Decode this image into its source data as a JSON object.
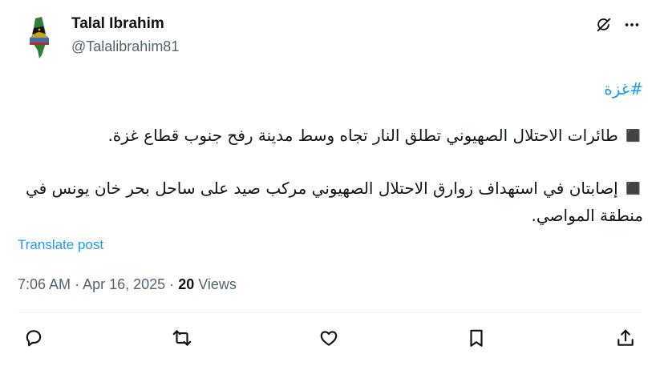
{
  "author": {
    "name": "Talal Ibrahim",
    "handle": "@Talalibrahim81"
  },
  "post": {
    "hashtag": "#غزة",
    "paragraph_1": "◼️ طائرات الاحتلال الصهيوني تطلق النار تجاه وسط مدينة رفح جنوب قطاع غزة.",
    "paragraph_2": "◼️ إصابتان في استهداف زوارق الاحتلال الصهيوني مركب صيد على ساحل بحر خان يونس في منطقة المواصي."
  },
  "translate_label": "Translate post",
  "meta": {
    "time": "7:06 AM",
    "separator": "·",
    "date": "Apr 16, 2025",
    "views_count": "20",
    "views_label": "Views"
  },
  "icons": {
    "grok": "grok-icon",
    "more": "more-icon",
    "reply": "reply-icon",
    "retweet": "retweet-icon",
    "like": "like-icon",
    "bookmark": "bookmark-icon",
    "share": "share-icon"
  },
  "colors": {
    "text": "#0f1419",
    "secondary": "#536471",
    "link": "#1d9bf0",
    "divider": "#eff3f4"
  }
}
